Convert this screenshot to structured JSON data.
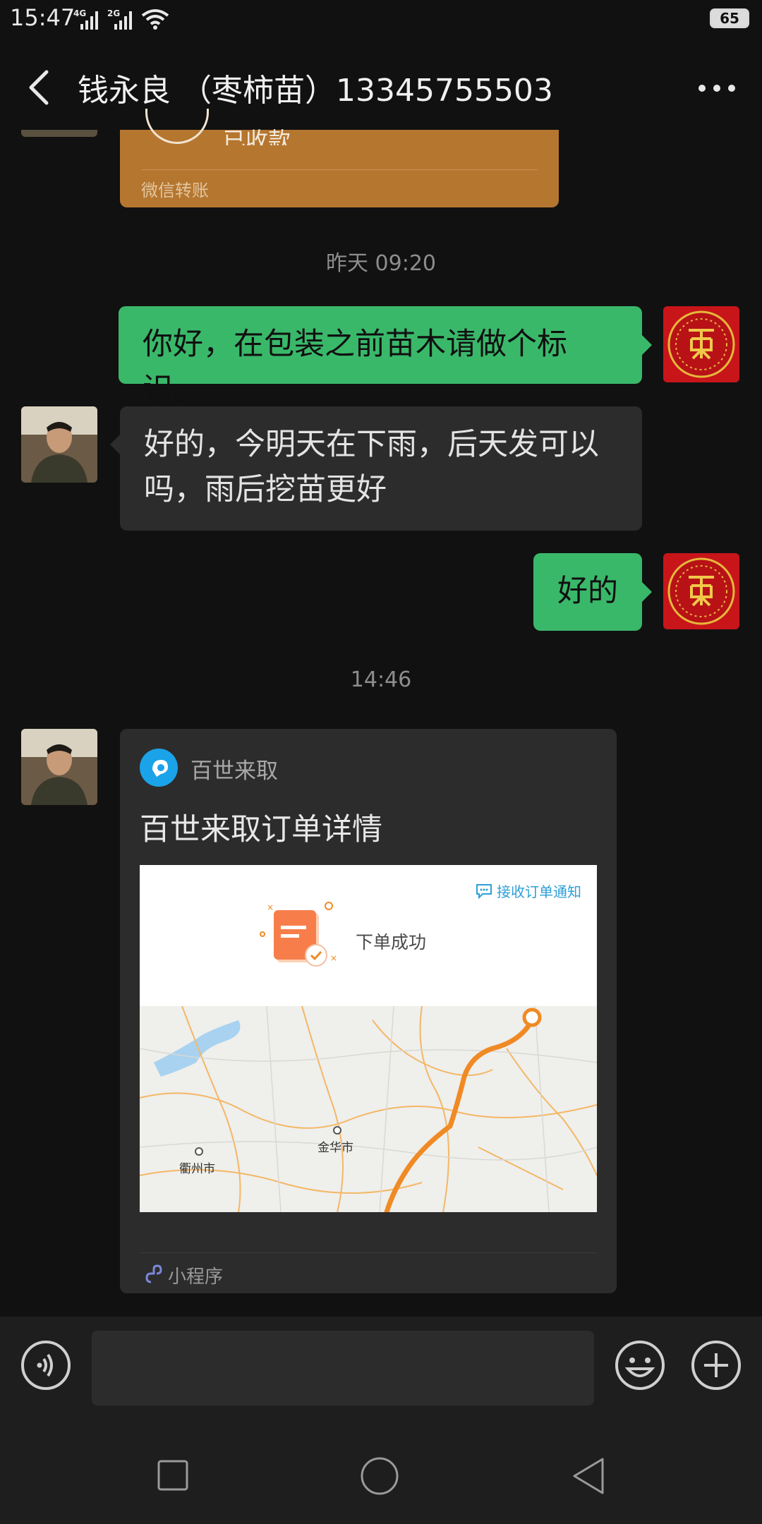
{
  "status_bar": {
    "time": "15:47",
    "network_1": "4G",
    "network_2": "2G",
    "battery": "65"
  },
  "header": {
    "title": "钱永良 （枣柿苗）13345755503",
    "back_icon": "chevron-left-icon",
    "more_icon": "more-horizontal-icon"
  },
  "transfer_card": {
    "status": "已收款",
    "footer": "微信转账",
    "color": "#b5762f"
  },
  "messages": [
    {
      "type": "timestamp",
      "text": "昨天 09:20"
    },
    {
      "type": "sent",
      "text": "你好，在包装之前苗木请做个标识。"
    },
    {
      "type": "received",
      "text": "好的，今明天在下雨，后天发可以吗，雨后挖苗更好"
    },
    {
      "type": "sent",
      "text": "好的"
    },
    {
      "type": "timestamp",
      "text": "14:46"
    }
  ],
  "mini_program": {
    "app_name": "百世来取",
    "title": "百世来取订单详情",
    "notify_link": "接收订单通知",
    "order_status": "下单成功",
    "map_labels": [
      "金华市",
      "衢州市"
    ],
    "footer": "小程序",
    "route_color": "#f08a24"
  },
  "input_bar": {
    "voice_icon": "voice-icon",
    "emoji_icon": "emoji-icon",
    "plus_icon": "plus-icon"
  },
  "nav_bar": {
    "icons": [
      "square-icon",
      "circle-icon",
      "triangle-back-icon"
    ]
  },
  "colors": {
    "sent_bubble": "#3ab86a",
    "received_bubble": "#2c2c2c",
    "background": "#111111"
  }
}
